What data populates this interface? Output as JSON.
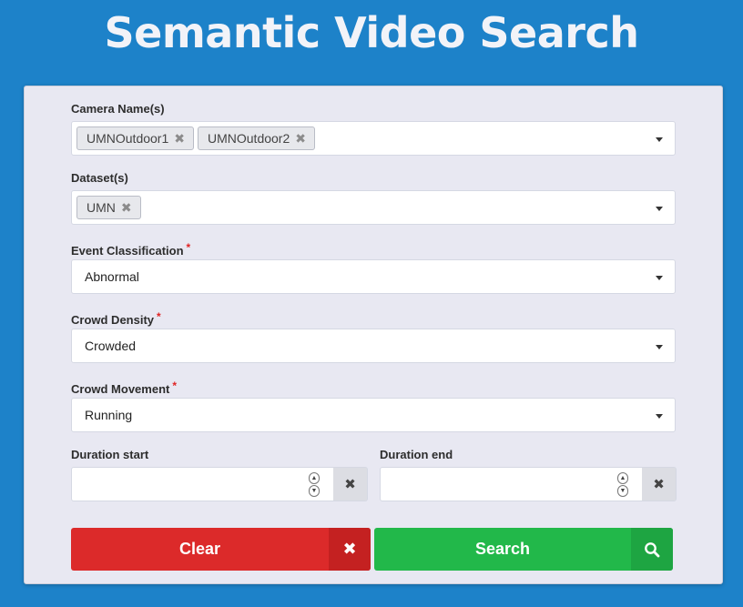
{
  "title": "Semantic Video Search",
  "form": {
    "camera": {
      "label": "Camera Name(s)",
      "chips": [
        "UMNOutdoor1",
        "UMNOutdoor2"
      ]
    },
    "dataset": {
      "label": "Dataset(s)",
      "chips": [
        "UMN"
      ]
    },
    "event": {
      "label": "Event Classification",
      "required": "*",
      "value": "Abnormal"
    },
    "density": {
      "label": "Crowd Density",
      "required": "*",
      "value": "Crowded"
    },
    "movement": {
      "label": "Crowd Movement",
      "required": "*",
      "value": "Running"
    },
    "duration_start": {
      "label": "Duration start",
      "value": "",
      "clear_icon": "✖"
    },
    "duration_end": {
      "label": "Duration end",
      "value": "",
      "clear_icon": "✖"
    }
  },
  "actions": {
    "clear_label": "Clear",
    "clear_icon": "✖",
    "search_label": "Search"
  },
  "chip_remove_glyph": "✖",
  "spinner": {
    "up": "▲",
    "down": "▼"
  },
  "colors": {
    "background": "#1d82c9",
    "panel": "#e8e8f2",
    "clear": "#dc2a2a",
    "search": "#22b84a",
    "required": "#e02424"
  }
}
